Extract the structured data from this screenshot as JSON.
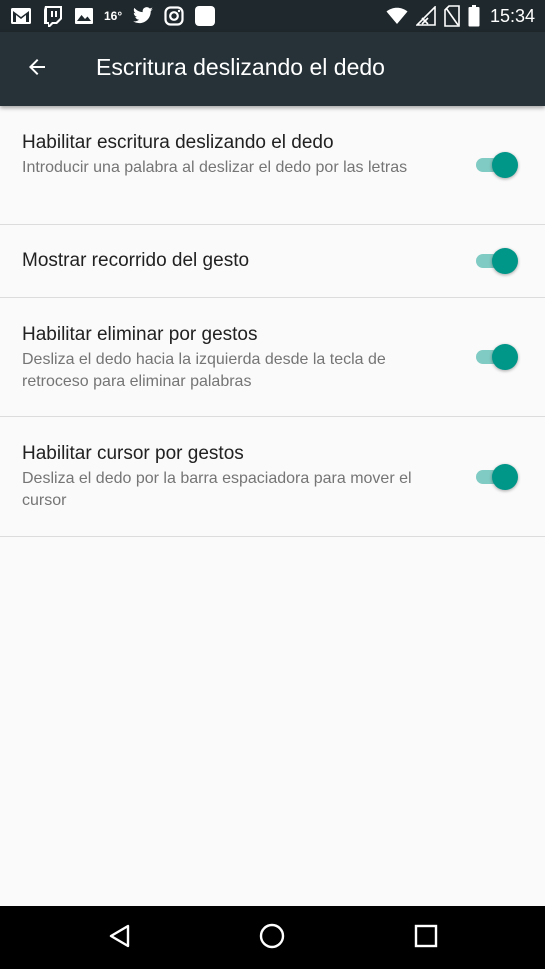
{
  "status_bar": {
    "temperature": "16°",
    "time": "15:34",
    "left_icons": [
      "gmail-icon",
      "twitch-icon",
      "image-icon",
      "weather-temp",
      "twitter-icon",
      "instagram-icon",
      "app-square-icon"
    ],
    "right_icons": [
      "wifi-icon",
      "cellular-no-signal-icon",
      "sim-missing-icon",
      "battery-icon"
    ]
  },
  "app_bar": {
    "title": "Escritura deslizando el dedo",
    "back_icon": "arrow-back-icon"
  },
  "settings": [
    {
      "title": "Habilitar escritura deslizando el dedo",
      "summary": "Introducir una palabra al deslizar el dedo por las letras",
      "enabled": true
    },
    {
      "title": "Mostrar recorrido del gesto",
      "summary": "",
      "enabled": true
    },
    {
      "title": "Habilitar eliminar por gestos",
      "summary": "Desliza el dedo hacia la izquierda desde la tecla de retroceso para eliminar palabras",
      "enabled": true
    },
    {
      "title": "Habilitar cursor por gestos",
      "summary": "Desliza el dedo por la barra espaciadora para mover el cursor",
      "enabled": true
    }
  ],
  "nav_bar": {
    "icons": [
      "back-triangle-icon",
      "home-circle-icon",
      "recents-square-icon"
    ]
  },
  "colors": {
    "status_bar": "#1f282d",
    "app_bar": "#263238",
    "accent": "#009688",
    "accent_track": "#80cbc4",
    "background": "#fafafa"
  }
}
